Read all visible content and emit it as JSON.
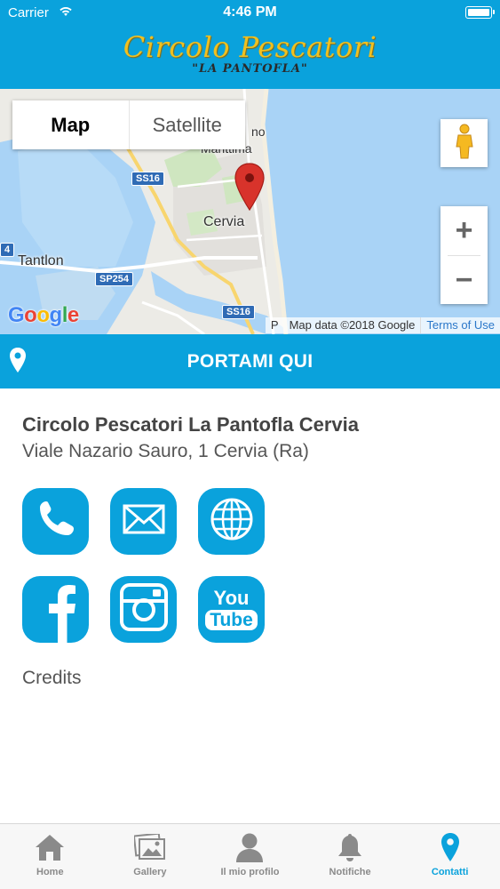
{
  "status_bar": {
    "carrier": "Carrier",
    "time": "4:46 PM"
  },
  "header": {
    "title": "Circolo Pescatori",
    "subtitle": "\"LA PANTOFLA\""
  },
  "map": {
    "type_tabs": {
      "map": "Map",
      "satellite": "Satellite",
      "selected": "Map"
    },
    "zoom_in": "+",
    "zoom_out": "−",
    "google": [
      "G",
      "o",
      "o",
      "g",
      "l",
      "e"
    ],
    "attribution": "Map data ©2018 Google",
    "attribution_prefix": "P",
    "terms": "Terms of Use",
    "labels": {
      "cervia": "Cervia",
      "tantlon": "Tantlon",
      "marittima": "Marittima",
      "milano_fragment": "no",
      "left_number": "4"
    },
    "roads": {
      "ss16_a": "SS16",
      "ss16_b": "SS16",
      "sp254": "SP254"
    }
  },
  "directions": {
    "label": "PORTAMI QUI"
  },
  "place": {
    "name": "Circolo Pescatori La Pantofla Cervia",
    "address": "Viale Nazario Sauro, 1 Cervia (Ra)"
  },
  "contact_icons": [
    "phone-icon",
    "mail-icon",
    "globe-icon",
    "facebook-icon",
    "instagram-icon",
    "youtube-icon"
  ],
  "youtube_text": {
    "you": "You",
    "tube": "Tube"
  },
  "credits": "Credits",
  "tabbar": {
    "items": [
      {
        "label": "Home",
        "icon": "home-icon"
      },
      {
        "label": "Gallery",
        "icon": "gallery-icon"
      },
      {
        "label": "Il mio profilo",
        "icon": "profile-icon"
      },
      {
        "label": "Notifiche",
        "icon": "bell-icon"
      },
      {
        "label": "Contatti",
        "icon": "location-pin-icon"
      }
    ],
    "active": "Contatti"
  },
  "colors": {
    "brand": "#0aa2dc",
    "logo_gold": "#f0c020",
    "pin_red": "#d8332b",
    "tab_inactive": "#8a8a8a"
  }
}
